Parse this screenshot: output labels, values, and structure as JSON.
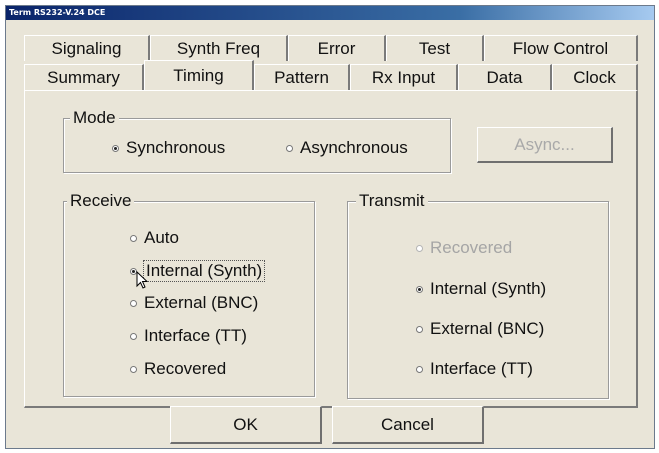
{
  "window": {
    "title": "Term RS232-V.24 DCE"
  },
  "tabs": {
    "back_row": [
      "Signaling",
      "Synth Freq",
      "Error",
      "Test",
      "Flow Control"
    ],
    "front_row": [
      "Summary",
      "Timing",
      "Pattern",
      "Rx Input",
      "Data",
      "Clock"
    ],
    "active": "Timing"
  },
  "mode": {
    "label": "Mode",
    "options": [
      {
        "label": "Synchronous",
        "selected": true
      },
      {
        "label": "Asynchronous",
        "selected": false
      }
    ],
    "async_button": "Async..."
  },
  "receive": {
    "label": "Receive",
    "options": [
      {
        "label": "Auto",
        "selected": false
      },
      {
        "label": "Internal (Synth)",
        "selected": true
      },
      {
        "label": "External (BNC)",
        "selected": false
      },
      {
        "label": "Interface (TT)",
        "selected": false
      },
      {
        "label": "Recovered",
        "selected": false
      }
    ]
  },
  "transmit": {
    "label": "Transmit",
    "options": [
      {
        "label": "Recovered",
        "selected": false,
        "disabled": true
      },
      {
        "label": "Internal (Synth)",
        "selected": true
      },
      {
        "label": "External (BNC)",
        "selected": false
      },
      {
        "label": "Interface (TT)",
        "selected": false
      }
    ]
  },
  "footer": {
    "ok": "OK",
    "cancel": "Cancel"
  }
}
